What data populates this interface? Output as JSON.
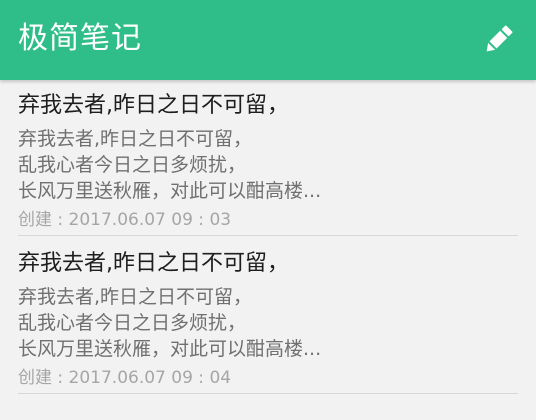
{
  "app_bar": {
    "title": "极简笔记",
    "edit_icon": "pencil-icon",
    "color": "#2fbe8a"
  },
  "notes": [
    {
      "title": "弃我去者,昨日之日不可留，",
      "preview": [
        "弃我去者,昨日之日不可留，",
        "乱我心者今日之日多烦扰，",
        "长风万里送秋雁，对此可以酣高楼..."
      ],
      "date": "创建 : 2017.06.07    09 : 03"
    },
    {
      "title": "弃我去者,昨日之日不可留，",
      "preview": [
        "弃我去者,昨日之日不可留，",
        "乱我心者今日之日多烦扰，",
        "长风万里送秋雁，对此可以酣高楼..."
      ],
      "date": "创建 : 2017.06.07    09 : 04"
    }
  ]
}
